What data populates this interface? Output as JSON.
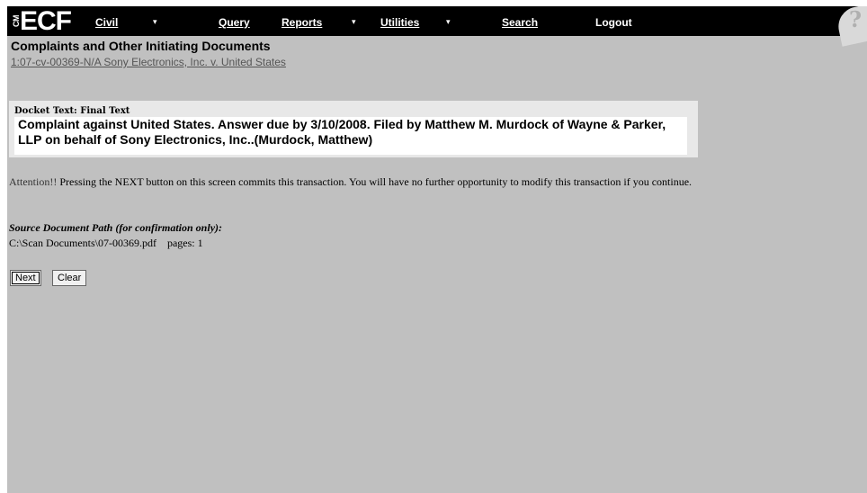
{
  "menubar": {
    "logo_cm": "CM",
    "logo_ecf": "ECF",
    "items": [
      {
        "label": "Civil",
        "has_dropdown": true
      },
      {
        "label": "Query",
        "has_dropdown": false
      },
      {
        "label": "Reports",
        "has_dropdown": true
      },
      {
        "label": "Utilities",
        "has_dropdown": true
      },
      {
        "label": "Search",
        "has_dropdown": false
      },
      {
        "label": "Logout",
        "has_dropdown": false
      }
    ],
    "dropdown_glyph": "▾",
    "help_glyph": "?"
  },
  "page": {
    "title": "Complaints and Other Initiating Documents",
    "case_link": "1:07-cv-00369-N/A Sony Electronics, Inc. v. United States"
  },
  "docket": {
    "label": "Docket Text: Final Text",
    "text": "Complaint against United States. Answer due by 3/10/2008. Filed by Matthew M. Murdock of Wayne & Parker, LLP on behalf of Sony Electronics, Inc..(Murdock, Matthew)"
  },
  "attention": {
    "lead": "Attention!!",
    "text": "Pressing the NEXT button on this screen commits this transaction. You will have no further opportunity to modify this transaction if you continue."
  },
  "source": {
    "label": "Source Document Path (for confirmation only):",
    "path": "C:\\Scan Documents\\07-00369.pdf",
    "pages": "pages: 1"
  },
  "buttons": {
    "next": "Next",
    "clear": "Clear"
  },
  "colors": {
    "background": "#c0c0c0",
    "menubar": "#000000",
    "docket_box": "#e8e8e8"
  }
}
